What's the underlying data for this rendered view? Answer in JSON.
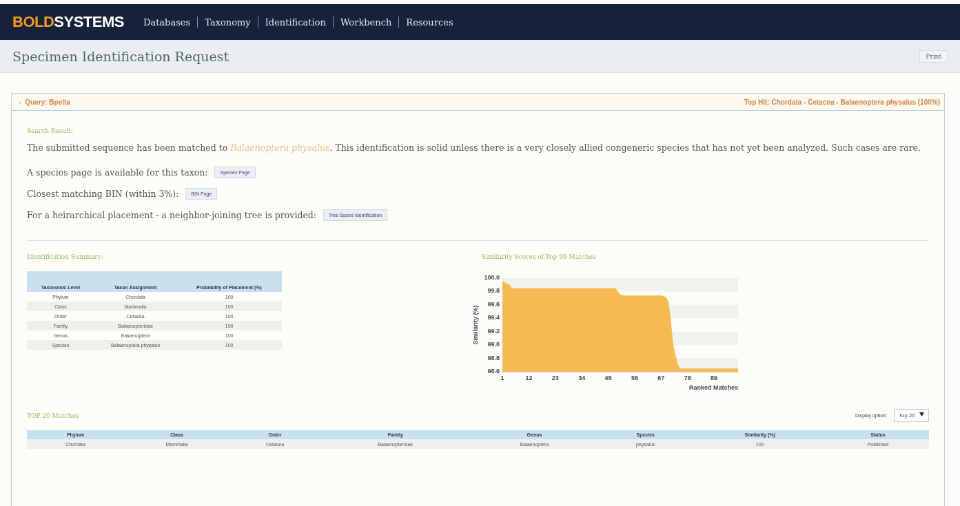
{
  "nav": {
    "logo_bold": "BOLD",
    "logo_rest": "SYSTEMS",
    "items": [
      {
        "label": "Databases"
      },
      {
        "label": "Taxonomy"
      },
      {
        "label": "Identification"
      },
      {
        "label": "Workbench"
      },
      {
        "label": "Resources"
      }
    ]
  },
  "title_bar": {
    "title": "Specimen Identification Request",
    "print": "Print"
  },
  "panel": {
    "toggle": "-",
    "query": "Query: Bpelta",
    "top_hit": "Top Hit: Chordata - Cetacea - Balaenoptera physalus (100%)",
    "search_result_heading": "Search Result:",
    "result_before": "The submitted sequence has been matched to ",
    "result_species": "Balaenoptera physalus",
    "result_after": ". This identification is solid unless there is a very closely allied congeneric species that has not yet been analyzed. Such cases are rare.",
    "links": [
      {
        "text": "A species page is available for this taxon:",
        "button": "Species Page"
      },
      {
        "text": "Closest matching BIN (within 3%):",
        "button": "BIN Page"
      },
      {
        "text": "For a heirarchical placement - a neighbor-joining tree is provided:",
        "button": "Tree Based Identification"
      }
    ],
    "summary": {
      "heading": "Identification Summary:",
      "columns": [
        "Taxonomic Level",
        "Taxon Assignment",
        "Probability of Placement (%)"
      ],
      "rows": [
        [
          "Phylum",
          "Chordata",
          "100"
        ],
        [
          "Class",
          "Mammalia",
          "100"
        ],
        [
          "Order",
          "Cetacea",
          "100"
        ],
        [
          "Family",
          "Balaenopteridae",
          "100"
        ],
        [
          "Genus",
          "Balaenoptera",
          "100"
        ],
        [
          "Species",
          "Balaenoptera physalus",
          "100"
        ]
      ]
    },
    "chart_heading": "Similarity Scores of Top 99 Matches",
    "chart_data": {
      "type": "area",
      "xlabel": "Ranked Matches",
      "ylabel": "Similarity (%)",
      "x": [
        1,
        4,
        5,
        6,
        48,
        50,
        52,
        67,
        69,
        70,
        71,
        72,
        74,
        75,
        99
      ],
      "series": [
        {
          "color": "#f6ba52",
          "values": [
            99.95,
            99.9,
            99.85,
            99.85,
            99.85,
            99.75,
            99.74,
            99.74,
            99.72,
            99.65,
            99.4,
            99.0,
            98.7,
            98.65,
            98.65
          ]
        }
      ],
      "ylim": [
        98.6,
        100
      ],
      "xlim": [
        1,
        99
      ],
      "yticks": [
        {
          "value": 98.6,
          "label": "98.6"
        },
        {
          "value": 98.8,
          "label": "98.8"
        },
        {
          "value": 99.0,
          "label": "99.0"
        },
        {
          "value": 99.2,
          "label": "99.2"
        },
        {
          "value": 99.4,
          "label": "99.4"
        },
        {
          "value": 99.6,
          "label": "99.6"
        },
        {
          "value": 99.8,
          "label": "99.8"
        },
        {
          "value": 100,
          "label": "100.0"
        }
      ],
      "xticks": [
        1,
        12,
        23,
        34,
        45,
        56,
        67,
        78,
        89
      ]
    },
    "matches": {
      "heading": "TOP 20 Matches",
      "display_label": "Display option:",
      "display_value": "Top 20",
      "columns": [
        "Phylum",
        "Class",
        "Order",
        "Family",
        "Genus",
        "Species",
        "Similarity (%)",
        "Status"
      ],
      "rows": [
        [
          "Chordata",
          "Mammalia",
          "Cetacea",
          "Balaenopteridae",
          "Balaenoptera",
          "physalus",
          "100",
          "Published"
        ]
      ]
    }
  }
}
